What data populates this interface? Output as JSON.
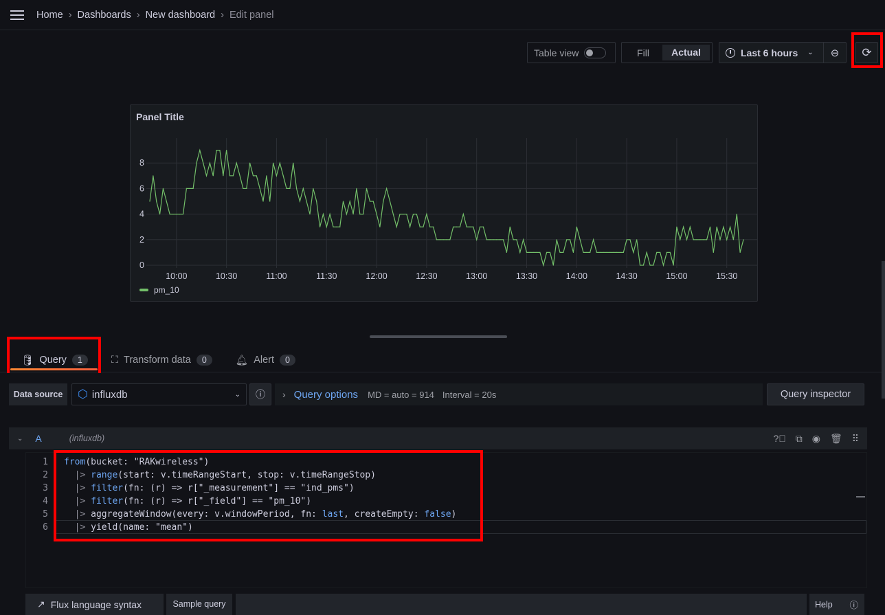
{
  "breadcrumb": [
    "Home",
    "Dashboards",
    "New dashboard",
    "Edit panel"
  ],
  "toolbar": {
    "table_view": "Table view",
    "table_view_on": false,
    "fill": "Fill",
    "actual": "Actual",
    "active_mode": "Actual",
    "time_range": "Last 6 hours"
  },
  "panel": {
    "title": "Panel Title"
  },
  "chart_data": {
    "type": "line",
    "title": "Panel Title",
    "xlabel": "",
    "ylabel": "",
    "x_ticks": [
      "10:00",
      "10:30",
      "11:00",
      "11:30",
      "12:00",
      "12:30",
      "13:00",
      "13:30",
      "14:00",
      "14:30",
      "15:00",
      "15:30"
    ],
    "y_ticks": [
      0,
      2,
      4,
      6,
      8
    ],
    "ylim": [
      0,
      10
    ],
    "xlim": [
      "09:44",
      "15:40"
    ],
    "grid": true,
    "legend": "bottom-left",
    "series": [
      {
        "name": "pm_10",
        "color": "#73bf69",
        "x": [
          "09:44",
          "09:46",
          "09:48",
          "09:50",
          "09:52",
          "09:54",
          "09:56",
          "09:58",
          "10:00",
          "10:02",
          "10:04",
          "10:06",
          "10:08",
          "10:10",
          "10:12",
          "10:14",
          "10:16",
          "10:18",
          "10:20",
          "10:22",
          "10:24",
          "10:26",
          "10:28",
          "10:30",
          "10:32",
          "10:34",
          "10:36",
          "10:38",
          "10:40",
          "10:42",
          "10:44",
          "10:46",
          "10:48",
          "10:50",
          "10:52",
          "10:54",
          "10:56",
          "10:58",
          "11:00",
          "11:02",
          "11:04",
          "11:06",
          "11:08",
          "11:10",
          "11:12",
          "11:14",
          "11:16",
          "11:18",
          "11:20",
          "11:22",
          "11:24",
          "11:26",
          "11:28",
          "11:30",
          "11:32",
          "11:34",
          "11:36",
          "11:38",
          "11:40",
          "11:42",
          "11:44",
          "11:46",
          "11:48",
          "11:50",
          "11:52",
          "11:54",
          "11:56",
          "11:58",
          "12:00",
          "12:02",
          "12:04",
          "12:06",
          "12:08",
          "12:10",
          "12:12",
          "12:14",
          "12:16",
          "12:18",
          "12:20",
          "12:22",
          "12:24",
          "12:26",
          "12:28",
          "12:30",
          "12:32",
          "12:34",
          "12:36",
          "12:38",
          "12:40",
          "12:42",
          "12:44",
          "12:46",
          "12:48",
          "12:50",
          "12:52",
          "12:54",
          "12:56",
          "12:58",
          "13:00",
          "13:02",
          "13:04",
          "13:06",
          "13:08",
          "13:10",
          "13:12",
          "13:14",
          "13:16",
          "13:18",
          "13:20",
          "13:22",
          "13:24",
          "13:26",
          "13:28",
          "13:30",
          "13:32",
          "13:34",
          "13:36",
          "13:38",
          "13:40",
          "13:42",
          "13:44",
          "13:46",
          "13:48",
          "13:50",
          "13:52",
          "13:54",
          "13:56",
          "13:58",
          "14:00",
          "14:02",
          "14:04",
          "14:06",
          "14:08",
          "14:10",
          "14:12",
          "14:14",
          "14:16",
          "14:18",
          "14:20",
          "14:22",
          "14:24",
          "14:26",
          "14:28",
          "14:30",
          "14:32",
          "14:34",
          "14:36",
          "14:38",
          "14:40",
          "14:42",
          "14:44",
          "14:46",
          "14:48",
          "14:50",
          "14:52",
          "14:54",
          "14:56",
          "14:58",
          "15:00",
          "15:02",
          "15:04",
          "15:06",
          "15:08",
          "15:10",
          "15:12",
          "15:14",
          "15:16",
          "15:18",
          "15:20",
          "15:22",
          "15:24",
          "15:26",
          "15:28",
          "15:30",
          "15:32",
          "15:34",
          "15:36",
          "15:38",
          "15:40"
        ],
        "values": [
          5,
          7,
          5,
          4,
          6,
          5,
          4,
          4,
          4,
          4,
          4,
          6,
          6,
          6,
          8,
          9,
          8,
          7,
          8,
          7,
          9,
          9,
          7,
          9,
          7,
          7,
          8,
          7,
          6,
          6,
          8,
          7,
          7,
          6,
          5,
          7,
          5,
          8,
          7,
          8,
          7,
          6,
          6,
          8,
          6,
          5,
          6,
          5,
          4,
          6,
          5,
          3,
          4,
          3,
          4,
          3,
          3,
          3,
          5,
          4,
          5,
          4,
          6,
          4,
          4,
          6,
          5,
          5,
          4,
          3,
          5,
          6,
          5,
          4,
          3,
          4,
          4,
          4,
          3,
          4,
          4,
          3,
          3,
          4,
          3,
          3,
          2,
          2,
          2,
          2,
          2,
          3,
          3,
          3,
          4,
          3,
          3,
          3,
          2,
          3,
          3,
          2,
          2,
          2,
          2,
          2,
          2,
          1,
          3,
          2,
          2,
          1,
          2,
          1,
          1,
          1,
          1,
          1,
          0,
          1,
          1,
          0,
          2,
          1,
          1,
          2,
          2,
          1,
          3,
          2,
          1,
          1,
          1,
          2,
          1,
          1,
          1,
          1,
          1,
          1,
          1,
          1,
          1,
          2,
          2,
          1,
          2,
          0,
          0,
          1,
          0,
          0,
          1,
          1,
          0,
          1,
          1,
          0,
          3,
          2,
          3,
          2,
          3,
          2,
          2,
          2,
          2,
          2,
          3,
          1,
          3,
          2,
          3,
          2,
          3,
          2,
          4,
          1,
          2
        ]
      }
    ]
  },
  "tabs": [
    {
      "label": "Query",
      "count": "1",
      "active": true
    },
    {
      "label": "Transform data",
      "count": "0"
    },
    {
      "label": "Alert",
      "count": "0"
    }
  ],
  "query_bar": {
    "data_source_label": "Data source",
    "data_source": "influxdb",
    "query_options": "Query options",
    "md": "MD = auto = 914",
    "interval": "Interval = 20s",
    "inspector": "Query inspector"
  },
  "query": {
    "ref": "A",
    "source": "(influxdb)",
    "lines": [
      [
        [
          "from",
          "fn"
        ],
        [
          "(bucket: \"RAKwireless\")",
          ""
        ]
      ],
      [
        [
          "  |> ",
          "pipe"
        ],
        [
          "range",
          "fn"
        ],
        [
          "(start: v.timeRangeStart, stop: v.timeRangeStop)",
          ""
        ]
      ],
      [
        [
          "  |> ",
          "pipe"
        ],
        [
          "filter",
          "fn"
        ],
        [
          "(fn: (r) => r[\"_measurement\"] == \"ind_pms\")",
          ""
        ]
      ],
      [
        [
          "  |> ",
          "pipe"
        ],
        [
          "filter",
          "fn"
        ],
        [
          "(fn: (r) => r[\"_field\"] == \"pm_10\")",
          ""
        ]
      ],
      [
        [
          "  |> ",
          "pipe"
        ],
        [
          "aggregateWindow(every: v.windowPeriod, fn: ",
          ""
        ],
        [
          "last",
          "kw"
        ],
        [
          ", createEmpty: ",
          ""
        ],
        [
          "false",
          "kw"
        ],
        [
          ")",
          ""
        ]
      ],
      [
        [
          "  |> ",
          "pipe"
        ],
        [
          "yield(name: \"mean\")",
          ""
        ]
      ]
    ]
  },
  "footer": {
    "flux_syntax": "Flux language syntax",
    "sample_query": "Sample query",
    "help": "Help"
  }
}
